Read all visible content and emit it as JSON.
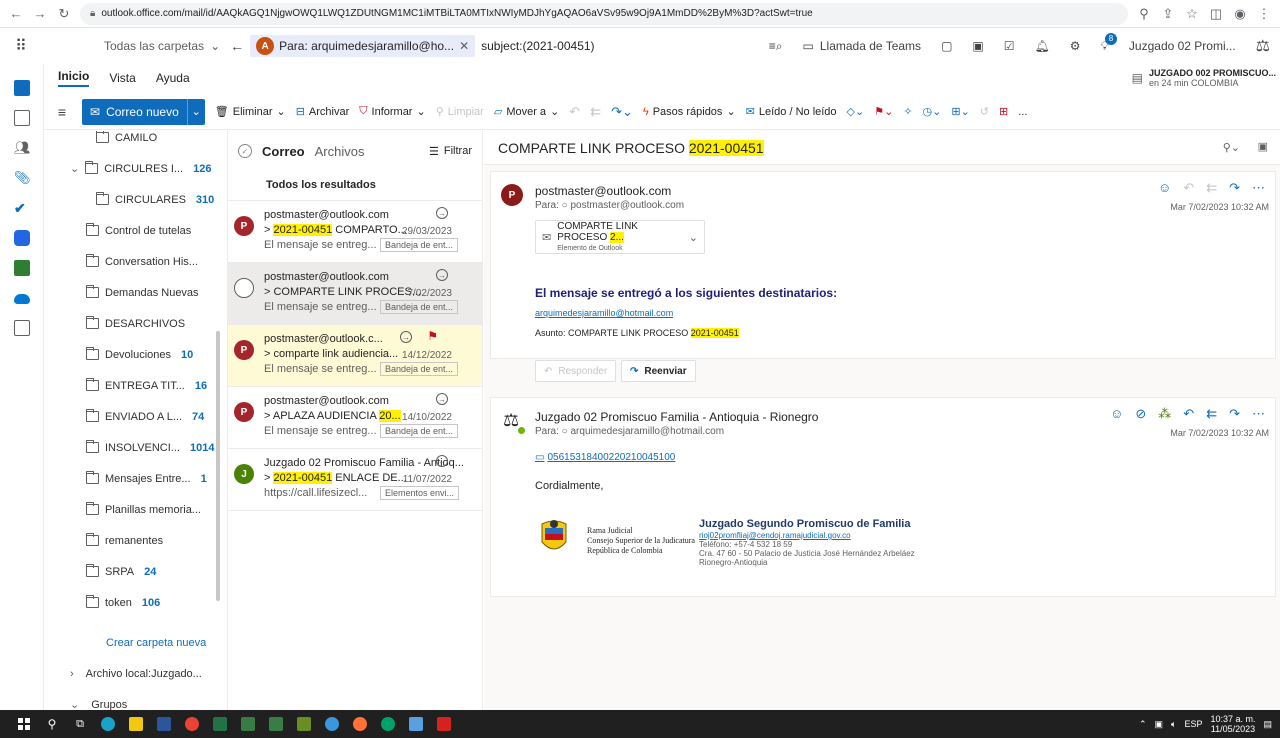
{
  "browser": {
    "url": "outlook.office.com/mail/id/AAQkAGQ1NjgwOWQ1LWQ1ZDUtNGM1MC1iMTBiLTA0MTIxNWIyMDJhYgAQAO6aVSv95w9Oj9A1MmDD%2ByM%3D?actSwt=true"
  },
  "header": {
    "scope_label": "Todas las carpetas",
    "recipient_filter": "Para: arquimedesjaramillo@ho...",
    "query": "subject:(2021-00451)",
    "teams_label": "Llamada de Teams",
    "account_name": "Juzgado 02 Promi...",
    "badge_count": "8"
  },
  "ribbon": {
    "tabs": [
      "Inicio",
      "Vista",
      "Ayuda"
    ],
    "new_mail": "Correo nuevo",
    "delete": "Eliminar",
    "archive": "Archivar",
    "report": "Informar",
    "clean": "Limpiar",
    "move": "Mover a",
    "quick_steps": "Pasos rápidos",
    "read_unread": "Leído / No leído",
    "more": "...",
    "notice_title": "JUZGADO 002 PROMISCUO...",
    "notice_sub": "en 24 min COLOMBIA"
  },
  "folders": [
    {
      "label": "CAMILO",
      "count": ""
    },
    {
      "label": "CIRCULRES I...",
      "count": "126"
    },
    {
      "label": "CIRCULARES",
      "count": "310"
    },
    {
      "label": "Control de tutelas",
      "count": ""
    },
    {
      "label": "Conversation His...",
      "count": ""
    },
    {
      "label": "Demandas Nuevas",
      "count": ""
    },
    {
      "label": "DESARCHIVOS",
      "count": ""
    },
    {
      "label": "Devoluciones",
      "count": "10"
    },
    {
      "label": "ENTREGA TIT...",
      "count": "16"
    },
    {
      "label": "ENVIADO A L...",
      "count": "74"
    },
    {
      "label": "INSOLVENCI...",
      "count": "1014"
    },
    {
      "label": "Mensajes Entre...",
      "count": "1"
    },
    {
      "label": "Planillas memoria...",
      "count": ""
    },
    {
      "label": "remanentes",
      "count": ""
    },
    {
      "label": "SRPA",
      "count": "24"
    },
    {
      "label": "token",
      "count": "106"
    }
  ],
  "folder_footer": {
    "create": "Crear carpeta nueva",
    "local": "Archivo local:Juzgado...",
    "groups": "Grupos"
  },
  "list": {
    "tab_mail": "Correo",
    "tab_files": "Archivos",
    "filter": "Filtrar",
    "section": "Todos los resultados",
    "items": [
      {
        "initial": "P",
        "color": "#a4262c",
        "from": "postmaster@outlook.com",
        "subj_pre": "> ",
        "subj_hl": "2021-00451",
        "subj_post": " COMPARTO...",
        "date": "29/03/2023",
        "preview": "El mensaje se entreg...",
        "folder": "Bandeja de ent..."
      },
      {
        "initial": "",
        "color": "#ffffff",
        "from": "postmaster@outlook.com",
        "subj_pre": "> COMPARTE LINK PROCES...",
        "subj_hl": "",
        "subj_post": "",
        "date": "7/02/2023",
        "preview": "El mensaje se entreg...",
        "folder": "Bandeja de ent..."
      },
      {
        "initial": "P",
        "color": "#a4262c",
        "from": "postmaster@outlook.c...",
        "subj_pre": "> comparte link audiencia...",
        "subj_hl": "",
        "subj_post": "",
        "date": "14/12/2022",
        "preview": "El mensaje se entreg...",
        "folder": "Bandeja de ent..."
      },
      {
        "initial": "P",
        "color": "#a4262c",
        "from": "postmaster@outlook.com",
        "subj_pre": "> APLAZA AUDIENCIA ",
        "subj_hl": "20...",
        "subj_post": "",
        "date": "14/10/2022",
        "preview": "El mensaje se entreg...",
        "folder": "Bandeja de ent..."
      },
      {
        "initial": "J",
        "color": "#498205",
        "from": "Juzgado 02 Promiscuo Familia - Antioq...",
        "subj_pre": "> ",
        "subj_hl": "2021-00451",
        "subj_post": " ENLACE DE...",
        "date": "11/07/2022",
        "preview": "https://call.lifesizecl...",
        "folder": "Elementos envi..."
      }
    ]
  },
  "reading": {
    "subject_pre": "COMPARTE LINK PROCESO ",
    "subject_hl": "2021-00451",
    "msg1": {
      "initial": "P",
      "sender": "postmaster@outlook.com",
      "to": "Para: ○ postmaster@outlook.com",
      "time": "Mar 7/02/2023 10:32 AM",
      "attach_title_pre": "COMPARTE LINK PROCESO ",
      "attach_title_hl": "2...",
      "attach_sub": "Elemento de Outlook",
      "heading": "El mensaje se entregó a los siguientes destinatarios:",
      "link": "arquimedesjaramillo@hotmail.com",
      "asunto_pre": "Asunto: COMPARTE LINK PROCESO ",
      "asunto_hl": "2021-00451",
      "reply": "Responder",
      "forward": "Reenviar"
    },
    "msg2": {
      "sender": "Juzgado 02 Promiscuo Familia - Antioquia - Rionegro",
      "to": "Para: ○ arquimedesjaramillo@hotmail.com",
      "time": "Mar 7/02/2023 10:32 AM",
      "attachment": "05615318400220210045100",
      "greeting": "Cordialmente,",
      "sig_org1": "Rama Judicial",
      "sig_org2": "Consejo Superior de la Judicatura",
      "sig_org3": "República de Colombia",
      "sig_name": "Juzgado Segundo Promiscuo de Familia",
      "sig_email": "rioj02promfliaj@cendoj.ramajudicial.gov.co",
      "sig_phone": "Teléfono: +57-4  532 18 59",
      "sig_addr": "Cra. 47 60 - 50 Palacio de Justicia José Hernández Arbeláez",
      "sig_city": "Rionegro-Antioquia"
    }
  },
  "taskbar": {
    "lang": "ESP",
    "time": "10:37 a. m.",
    "date": "11/05/2023"
  }
}
